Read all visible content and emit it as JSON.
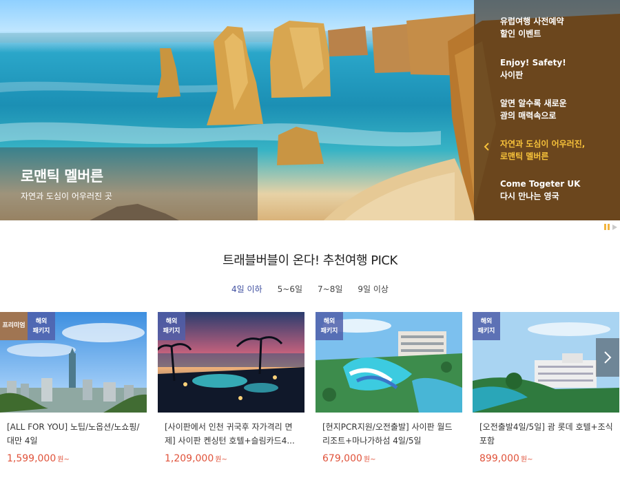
{
  "hero": {
    "title": "로맨틱 멜버른",
    "subtitle": "자연과 도심이 어우러진 곳",
    "menu": [
      {
        "label": "유럽여행 사전예약\n할인 이벤트"
      },
      {
        "label": "Enjoy! Safety!\n사이판"
      },
      {
        "label": "알면 알수록 새로운\n괌의 매력속으로"
      },
      {
        "label": "자연과 도심이 어우러진,\n로맨틱 멜버른",
        "active": true
      },
      {
        "label": "Come Togeter UK\n다시 만나는 영국"
      }
    ]
  },
  "section": {
    "title": "트래블버블이 온다! 추천여행 PICK",
    "tabs": [
      "4일 이하",
      "5~6일",
      "7~8일",
      "9일 이상"
    ],
    "active_tab": 0
  },
  "products": [
    {
      "badges": [
        "프리미엄",
        "해외\n패키지"
      ],
      "title": "[ALL FOR YOU] 노팁/노옵션/노쇼핑/\n대만 4일",
      "price": "1,599,000",
      "unit": "원~"
    },
    {
      "badges": [
        "해외\n패키지"
      ],
      "title": "[사이판에서 인천 귀국후 자가격리 면\n제] 사이판 켄싱턴 호텔+슬림카드4...",
      "price": "1,209,000",
      "unit": "원~"
    },
    {
      "badges": [
        "해외\n패키지"
      ],
      "title": "[현지PCR지원/오전출발] 사이판 월드\n리조트+마나가하섬 4일/5일",
      "price": "679,000",
      "unit": "원~"
    },
    {
      "badges": [
        "해외\n패키지"
      ],
      "title": "[오전출발4일/5일] 괌 롯데 호텔+조식\n포함",
      "price": "899,000",
      "unit": "원~"
    }
  ],
  "colors": {
    "accent": "#f7c23a",
    "price": "#e0523a",
    "tab_active": "#3f4fa0",
    "badge_pkg": "#505fa9",
    "badge_premium": "#a07552"
  },
  "icons": {
    "prev": "chevron-left-icon",
    "next": "chevron-right-icon",
    "pause": "pause-icon",
    "play": "play-icon"
  }
}
